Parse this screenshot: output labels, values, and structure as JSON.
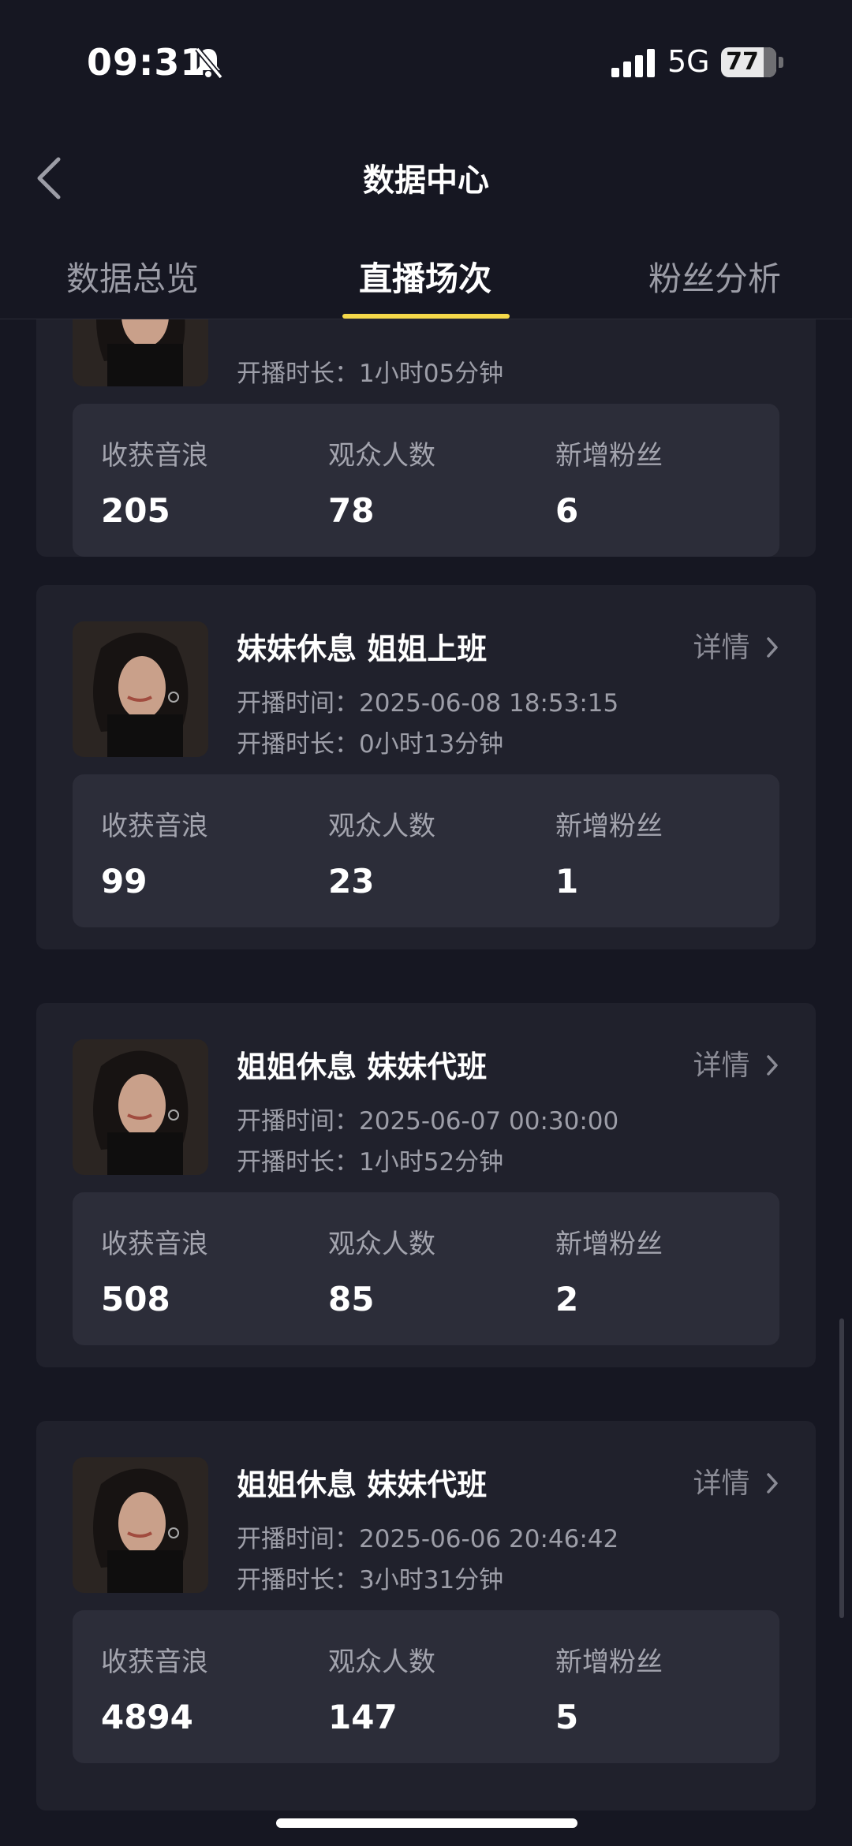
{
  "status_bar": {
    "time": "09:31",
    "network": "5G",
    "battery": "77"
  },
  "header": {
    "title": "数据中心"
  },
  "tabs": [
    {
      "label": "数据总览"
    },
    {
      "label": "直播场次"
    },
    {
      "label": "粉丝分析"
    }
  ],
  "labels": {
    "detail": "详情",
    "start_prefix": "开播时间：",
    "duration_prefix": "开播时长：",
    "stat_income": "收获音浪",
    "stat_viewers": "观众人数",
    "stat_fans": "新增粉丝"
  },
  "sessions": [
    {
      "name": "",
      "start": "",
      "duration": "1小时05分钟",
      "income": "205",
      "viewers": "78",
      "fans": "6"
    },
    {
      "name": "妹妹休息 姐姐上班",
      "start": "2025-06-08 18:53:15",
      "duration": "0小时13分钟",
      "income": "99",
      "viewers": "23",
      "fans": "1"
    },
    {
      "name": "姐姐休息 妹妹代班",
      "start": "2025-06-07 00:30:00",
      "duration": "1小时52分钟",
      "income": "508",
      "viewers": "85",
      "fans": "2"
    },
    {
      "name": "姐姐休息 妹妹代班",
      "start": "2025-06-06 20:46:42",
      "duration": "3小时31分钟",
      "income": "4894",
      "viewers": "147",
      "fans": "5"
    }
  ]
}
